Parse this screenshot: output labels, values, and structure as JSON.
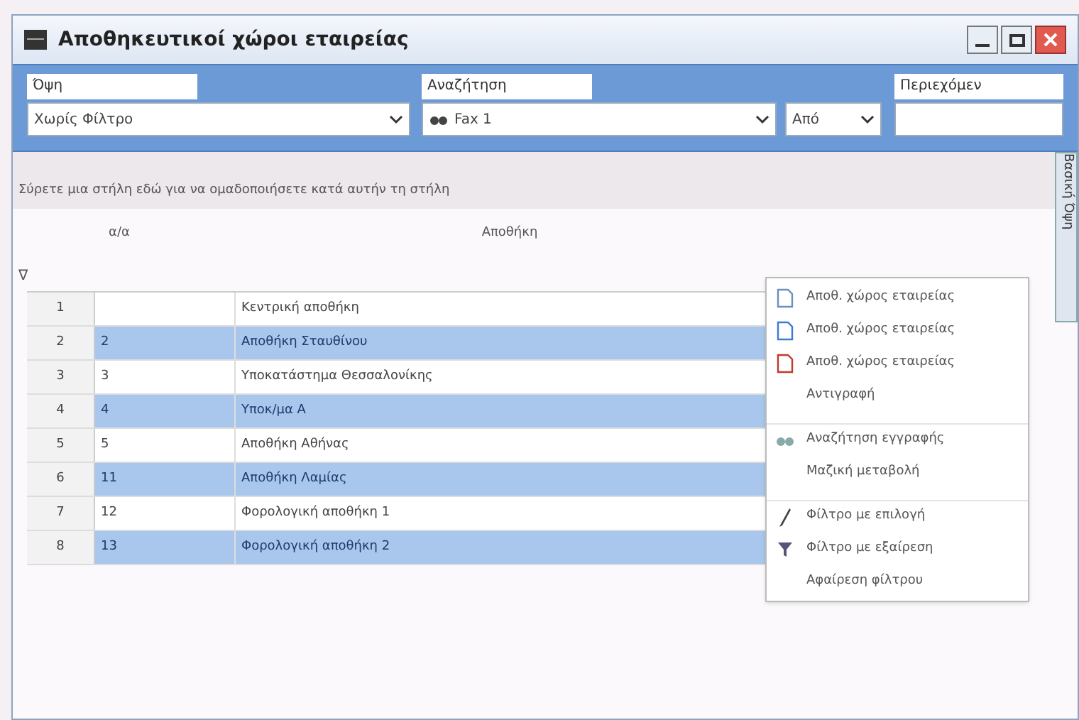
{
  "window": {
    "title": "Αποθηκευτικοί χώροι εταιρείας"
  },
  "filters": [
    {
      "kind": "select",
      "label": "Όψη",
      "value": "Χωρίς Φίλτρο"
    },
    {
      "kind": "search",
      "label": "Αναζήτηση",
      "value": "Fax 1",
      "operator": "Από"
    },
    {
      "kind": "text",
      "label": "Περιεχόμεν"
    }
  ],
  "group_hint": "Σύρετε μια στήλη εδώ για να ομαδοποιήσετε κατά αυτήν τη στήλη",
  "side_tab": "Βασική Όψη",
  "table": {
    "columns": [
      "α/α",
      "Αποθήκη"
    ],
    "filter_icon": "∇",
    "rows": [
      {
        "num": "1",
        "code": "",
        "name": "Κεντρική αποθήκη",
        "selected": false
      },
      {
        "num": "2",
        "code": "2",
        "name": "Αποθήκη Σταυθίνου",
        "selected": true
      },
      {
        "num": "3",
        "code": "3",
        "name": "Υποκατάστημα Θεσσαλονίκης",
        "selected": false
      },
      {
        "num": "4",
        "code": "4",
        "name": "Υποκ/μα Α",
        "selected": true
      },
      {
        "num": "5",
        "code": "5",
        "name": "Αποθήκη Αθήνας",
        "selected": false
      },
      {
        "num": "6",
        "code": "11",
        "name": "Αποθήκη Λαμίας",
        "selected": true
      },
      {
        "num": "7",
        "code": "12",
        "name": "Φορολογική αποθήκη 1",
        "selected": false
      },
      {
        "num": "8",
        "code": "13",
        "name": "Φορολογική αποθήκη 2",
        "selected": true
      }
    ]
  },
  "context_menu": [
    {
      "kind": "new",
      "label": "Αποθ. χώρος εταιρείας",
      "separator_before": false
    },
    {
      "kind": "edit",
      "label": "Αποθ. χώρος εταιρείας",
      "separator_before": false
    },
    {
      "kind": "delete",
      "label": "Αποθ. χώρος εταιρείας",
      "separator_before": false
    },
    {
      "kind": "plain",
      "label": "Αντιγραφή",
      "separator_before": false
    },
    {
      "kind": "find",
      "label": "Αναζήτηση εγγραφής",
      "separator_before": true
    },
    {
      "kind": "plain",
      "label": "Μαζική μεταβολή",
      "separator_before": false
    },
    {
      "kind": "filter",
      "label": "Φίλτρο με επιλογή",
      "separator_before": true
    },
    {
      "kind": "exclude",
      "label": "Φίλτρο με εξαίρεση",
      "separator_before": false
    },
    {
      "kind": "plain",
      "label": "Αφαίρεση φίλτρου",
      "separator_before": false
    }
  ]
}
